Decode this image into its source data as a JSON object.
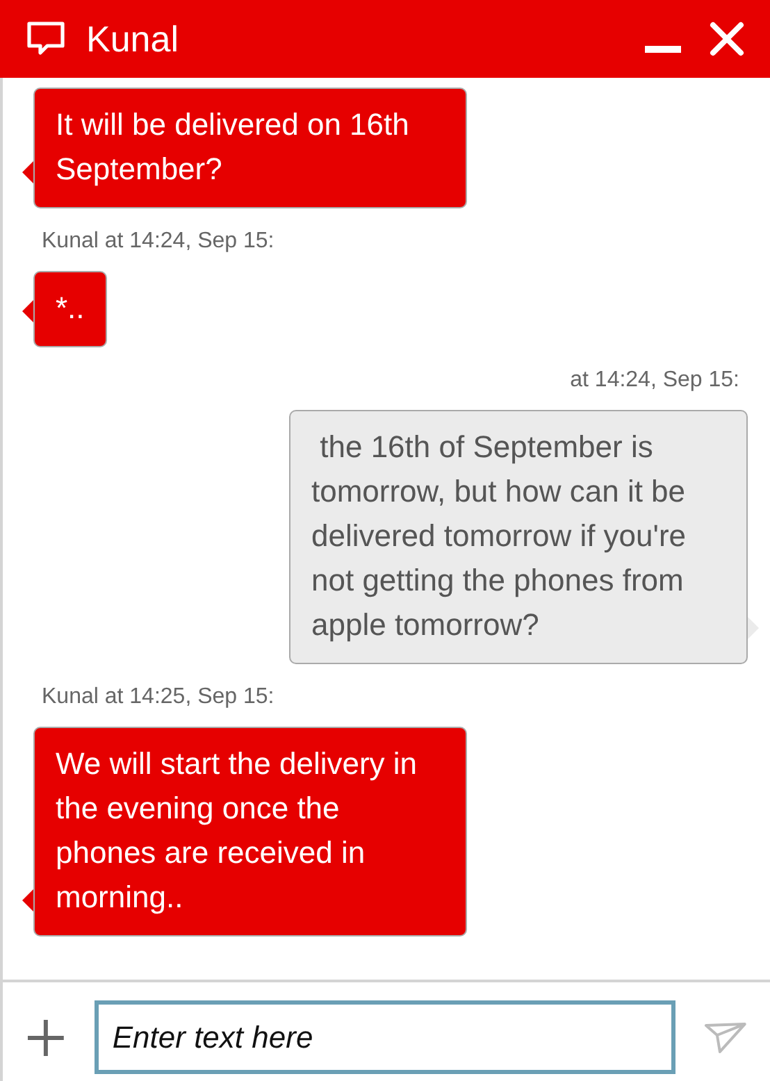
{
  "window": {
    "title": "Kunal"
  },
  "messages": [
    {
      "kind": "agent",
      "text": "It will be delivered on 16th September?"
    },
    {
      "kind": "agent",
      "meta": "Kunal at 14:24, Sep 15:",
      "text": "*.."
    },
    {
      "kind": "user",
      "meta": "at 14:24, Sep 15:",
      "text": " the 16th of September is tomorrow, but how can it be delivered tomorrow if you're not getting the phones from apple tomorrow?"
    },
    {
      "kind": "agent",
      "meta": "Kunal at 14:25, Sep 15:",
      "text": "We will start the delivery in the evening once the phones are received in morning.."
    }
  ],
  "composer": {
    "placeholder": "Enter text here"
  }
}
